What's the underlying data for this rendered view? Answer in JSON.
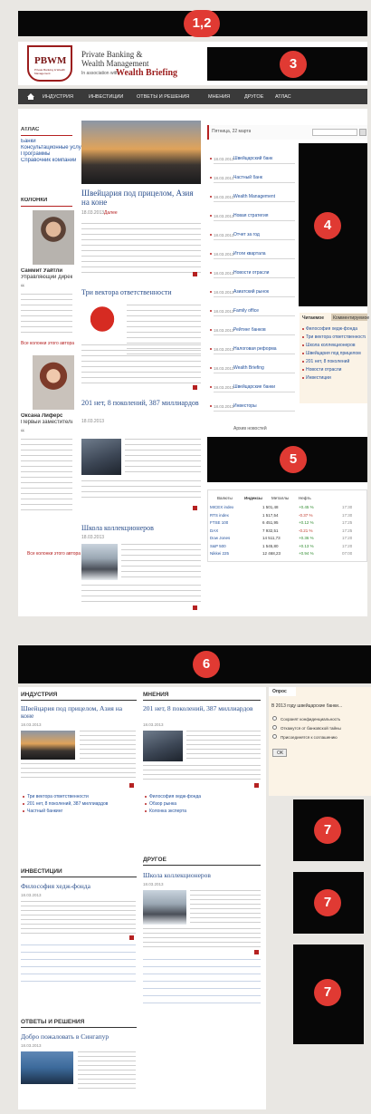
{
  "annotations": {
    "b12": "1,2",
    "b3": "3",
    "b4": "4",
    "b5": "5",
    "b6": "6",
    "b7": "7"
  },
  "header": {
    "logo": "PBWM",
    "logo_sub": "Private Banking & Wealth Management",
    "brand_line1": "Private Banking &",
    "brand_line2": "Wealth Management",
    "brand_assoc": "In association with",
    "brand_partner": "Wealth Briefing"
  },
  "nav": {
    "items": [
      "ИНДУСТРИЯ",
      "ИНВЕСТИЦИИ",
      "ОТВЕТЫ И РЕШЕНИЯ",
      "МНЕНИЯ",
      "ДРУГОЕ",
      "АТЛАС"
    ]
  },
  "left": {
    "atlas_title": "АТЛАС",
    "atlas_links": [
      "Банки",
      "Консультационные услуги",
      "Программы",
      "Справочник компаний"
    ],
    "columns_title": "КОЛОНКИ",
    "col1_name": "Саммит Уайтли",
    "col1_role": "Управляющий директор",
    "col1_link": "Все колонки этого автора",
    "col2_name": "Оксана Лиферс",
    "col2_role": "Первый заместитель председателя правления",
    "col2_link": "Все колонки этого автора"
  },
  "center": {
    "lead_title": "Швейцария под прицелом, Азия на коне",
    "lead_date": "18.03.2013",
    "lead_more": "Далее",
    "a2_title": "Три вектора ответственности",
    "a3_title": "201 нет, 8 поколений, 387 миллиардов",
    "a4_title": "Школа коллекционеров",
    "date_sample": "18.03.2013"
  },
  "news": {
    "header": "Пятница, 22 марта",
    "items": [
      "Швейцарский банк",
      "Частный банк",
      "Wealth Management",
      "Новая стратегия",
      "Отчет за год",
      "Итоги квартала",
      "Новости отрасли",
      "Азиатский рынок",
      "Family office",
      "Рейтинг банков",
      "Налоговая реформа",
      "Wealth Briefing",
      "Швейцарские банки",
      "Инвесторы"
    ],
    "archive": "Архив новостей"
  },
  "tabs": {
    "tab1": "Читаемое",
    "tab2": "Комментируемое",
    "list": [
      "Философия хедж-фонда",
      "Три вектора ответственности",
      "Школа коллекционеров",
      "Швейцария под прицелом",
      "201 нет, 8 поколений",
      "Новости отрасли",
      "Инвестиции"
    ]
  },
  "market": {
    "tabs": [
      "Валюты",
      "Индексы",
      "Металлы",
      "Нефть"
    ],
    "rows": [
      {
        "name": "MICEX index",
        "v": "1 501,48",
        "c": "+0.45 %",
        "t": "17:30"
      },
      {
        "name": "RTS index",
        "v": "1 517,54",
        "c": "-0.37 %",
        "t": "17:30"
      },
      {
        "name": "FTSE 100",
        "v": "6 451,95",
        "c": "+0.12 %",
        "t": "17:25"
      },
      {
        "name": "DAX",
        "v": "7 932,51",
        "c": "-0.21 %",
        "t": "17:25"
      },
      {
        "name": "Dow Jones",
        "v": "14 511,73",
        "c": "+0.36 %",
        "t": "17:20"
      },
      {
        "name": "S&P 500",
        "v": "1 545,80",
        "c": "+0.13 %",
        "t": "17:20"
      },
      {
        "name": "Nikkei 225",
        "v": "12 468,23",
        "c": "+0.94 %",
        "t": "07:00"
      }
    ]
  },
  "lower": {
    "industry_title": "ИНДУСТРИЯ",
    "industry_article": "Швейцария под прицелом, Азия на коне",
    "industry_links": [
      "Три вектора ответственности",
      "201 нет, 8 поколений, 387 миллиардов",
      "Частный банкинг"
    ],
    "opinions_title": "МНЕНИЯ",
    "opinions_article": "201 нет, 8 поколений, 387 миллиардов",
    "opinions_links": [
      "Философия хедж-фонда",
      "Обзор рынка",
      "Колонка эксперта"
    ],
    "investments_title": "ИНВЕСТИЦИИ",
    "investments_article": "Философия хедж-фонда",
    "other_title": "ДРУГОЕ",
    "other_article": "Школа коллекционеров",
    "answers_title": "ОТВЕТЫ И РЕШЕНИЯ",
    "answers_article": "Добро пожаловать в Сингапур"
  },
  "poll": {
    "tab": "Опрос",
    "question": "В 2013 году швейцарские банки...",
    "options": [
      "Сохранят конфиденциальность",
      "Откажутся от банковской тайны",
      "Присоединятся к соглашению"
    ],
    "vote": "OK"
  }
}
